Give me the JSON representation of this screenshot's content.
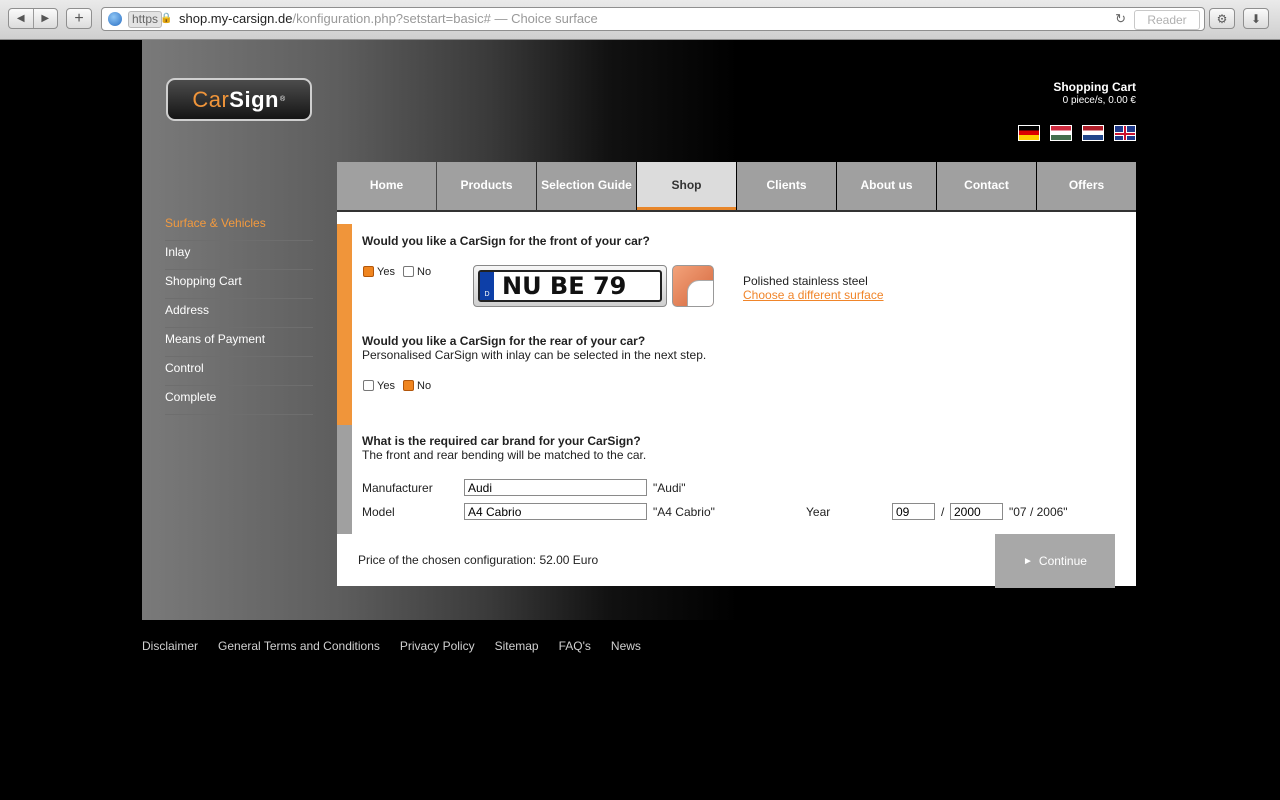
{
  "browser": {
    "https_label": "https",
    "url_host": "shop.my-carsign.de",
    "url_path": "/konfiguration.php?setstart=basic#",
    "page_title": " — Choice surface",
    "reader_label": "Reader"
  },
  "header": {
    "logo_car": "Car",
    "logo_sign": "Sign",
    "logo_reg": "®",
    "cart_title": "Shopping Cart",
    "cart_summary": "0 piece/s, 0.00 €"
  },
  "mainnav": [
    "Home",
    "Products",
    "Selection Guide",
    "Shop",
    "Clients",
    "About us",
    "Contact",
    "Offers"
  ],
  "sidenav": [
    "Surface & Vehicles",
    "Inlay",
    "Shopping Cart",
    "Address",
    "Means of Payment",
    "Control",
    "Complete"
  ],
  "front": {
    "question": "Would you like a CarSign for the front of your car?",
    "yes": "Yes",
    "no": "No",
    "plate_eu": "D",
    "plate_text": "NU BE 79",
    "surface_name": "Polished stainless steel",
    "surface_link": "Choose a different surface"
  },
  "rear": {
    "question": "Would you like a CarSign for the rear of your car?",
    "sub": "Personalised CarSign with inlay can be selected in the next step.",
    "yes": "Yes",
    "no": "No"
  },
  "brand": {
    "question": "What is the required car brand for your CarSign?",
    "sub": "The front and rear bending will be matched to the car.",
    "manufacturer_label": "Manufacturer",
    "manufacturer_value": "Audi",
    "manufacturer_echo": "\"Audi\"",
    "model_label": "Model",
    "model_value": "A4 Cabrio",
    "model_echo": "\"A4 Cabrio\"",
    "year_label": "Year",
    "month_value": "09",
    "slash": "/",
    "year_value": "2000",
    "year_echo": "\"07 / 2006\""
  },
  "price_text": "Price of the chosen configuration: 52.00 Euro",
  "continue_label": "Continue",
  "footer": [
    "Disclaimer",
    "General Terms and Conditions",
    "Privacy Policy",
    "Sitemap",
    "FAQ's",
    "News"
  ],
  "colors": {
    "accent": "#f0953a",
    "nav_gray": "#a0a0a0"
  }
}
